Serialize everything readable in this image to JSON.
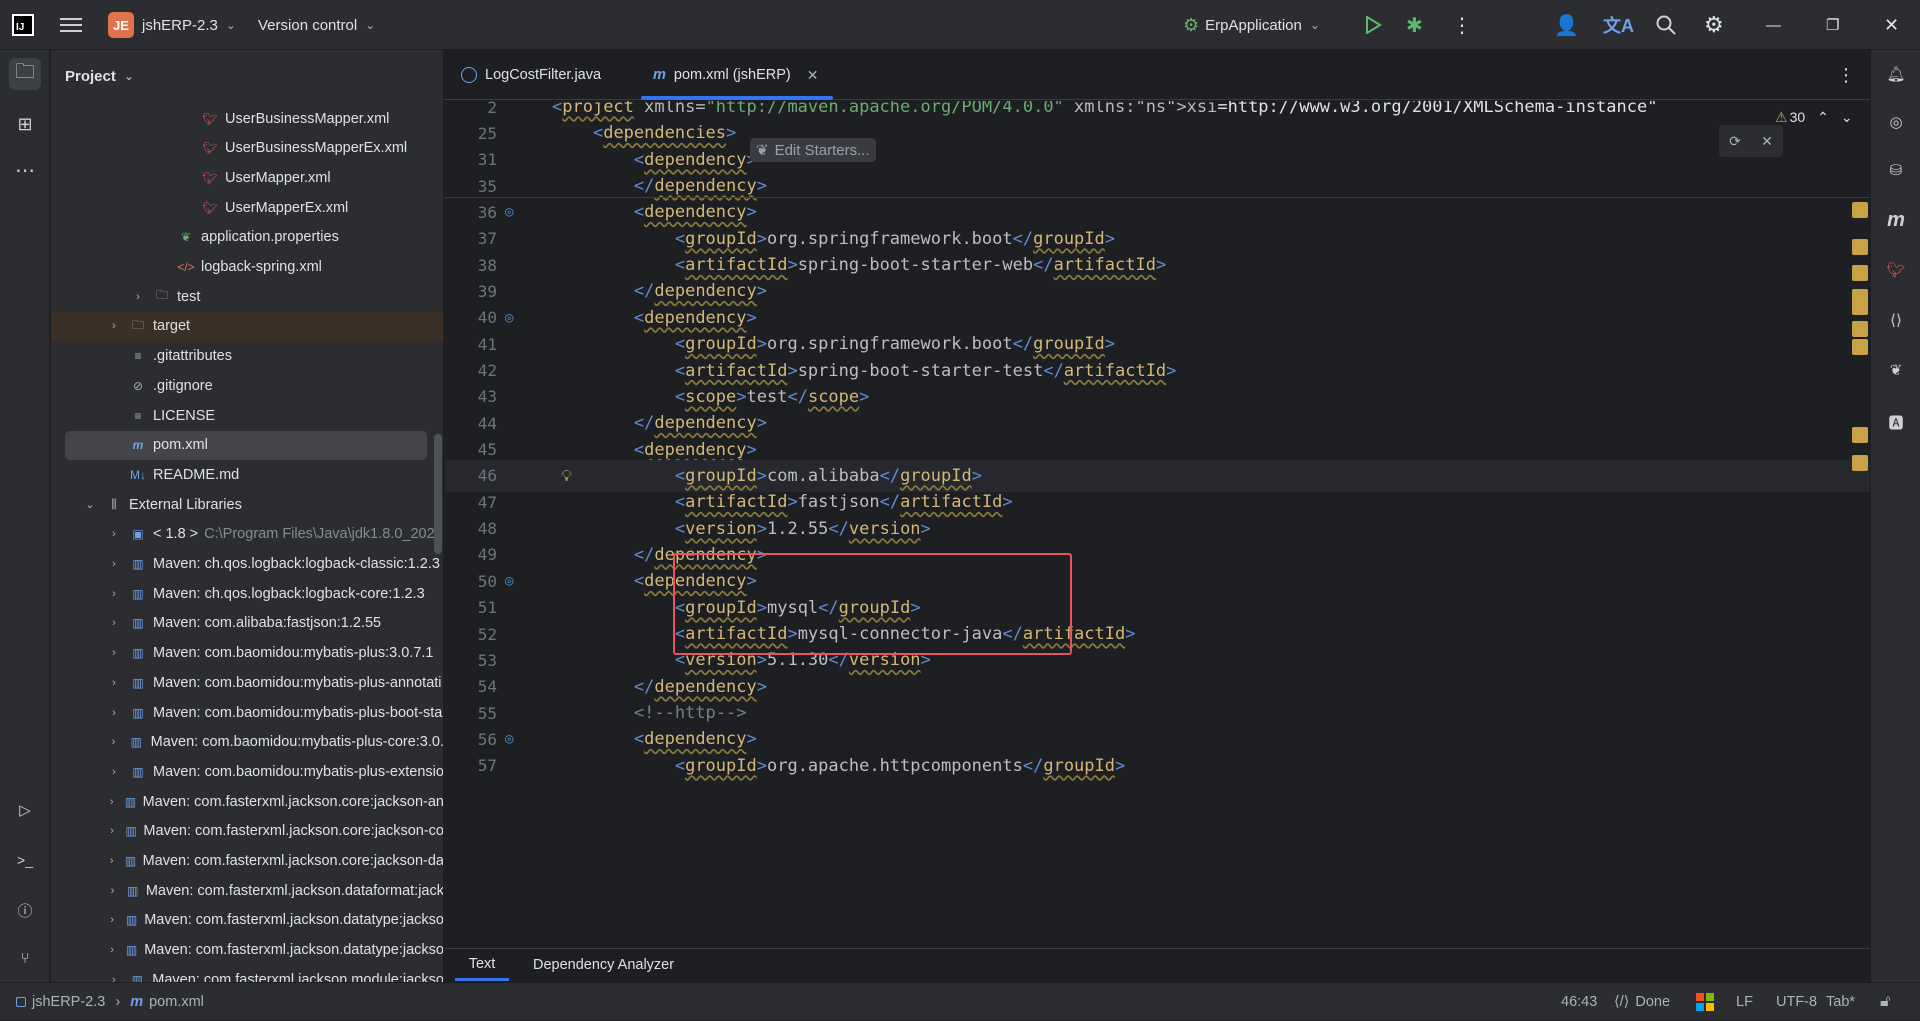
{
  "titlebar": {
    "project_badge": "JE",
    "project_name": "jshERP-2.3",
    "vcs_label": "Version control",
    "run_config": "ErpApplication"
  },
  "project_panel": {
    "title": "Project",
    "rows": [
      {
        "label": "UserBusinessMapper.xml",
        "icon": "mybatis-xml-icon",
        "level": 5
      },
      {
        "label": "UserBusinessMapperEx.xml",
        "icon": "mybatis-xml-icon",
        "level": 5
      },
      {
        "label": "UserMapper.xml",
        "icon": "mybatis-xml-icon",
        "level": 5
      },
      {
        "label": "UserMapperEx.xml",
        "icon": "mybatis-xml-icon",
        "level": 5
      },
      {
        "label": "application.properties",
        "icon": "spring-properties-icon",
        "level": 4
      },
      {
        "label": "logback-spring.xml",
        "icon": "xml-icon",
        "level": 4
      },
      {
        "label": "test",
        "icon": "folder-icon",
        "level": 3,
        "arrow": "›"
      },
      {
        "label": "target",
        "icon": "folder-icon",
        "level": 2,
        "arrow": "›"
      },
      {
        "label": ".gitattributes",
        "icon": "text-file-icon",
        "level": 2
      },
      {
        "label": ".gitignore",
        "icon": "ignore-file-icon",
        "level": 2
      },
      {
        "label": "LICENSE",
        "icon": "text-file-icon",
        "level": 2
      },
      {
        "label": "pom.xml",
        "icon": "maven-icon",
        "level": 2
      },
      {
        "label": "README.md",
        "icon": "markdown-icon",
        "level": 2
      },
      {
        "label": "External Libraries",
        "icon": "library-icon",
        "level": 1,
        "arrow": "⌄"
      },
      {
        "label": "< 1.8 >",
        "extra": "C:\\Program Files\\Java\\jdk1.8.0_202",
        "icon": "jdk-icon",
        "level": 2,
        "arrow": "›"
      },
      {
        "label": "Maven: ch.qos.logback:logback-classic:1.2.3",
        "icon": "jar-icon",
        "level": 2,
        "arrow": "›"
      },
      {
        "label": "Maven: ch.qos.logback:logback-core:1.2.3",
        "icon": "jar-icon",
        "level": 2,
        "arrow": "›"
      },
      {
        "label": "Maven: com.alibaba:fastjson:1.2.55",
        "icon": "jar-icon",
        "level": 2,
        "arrow": "›"
      },
      {
        "label": "Maven: com.baomidou:mybatis-plus:3.0.7.1",
        "icon": "jar-icon",
        "level": 2,
        "arrow": "›"
      },
      {
        "label": "Maven: com.baomidou:mybatis-plus-annotati",
        "icon": "jar-icon",
        "level": 2,
        "arrow": "›"
      },
      {
        "label": "Maven: com.baomidou:mybatis-plus-boot-sta",
        "icon": "jar-icon",
        "level": 2,
        "arrow": "›"
      },
      {
        "label": "Maven: com.baomidou:mybatis-plus-core:3.0.",
        "icon": "jar-icon",
        "level": 2,
        "arrow": "›"
      },
      {
        "label": "Maven: com.baomidou:mybatis-plus-extensio",
        "icon": "jar-icon",
        "level": 2,
        "arrow": "›"
      },
      {
        "label": "Maven: com.fasterxml.jackson.core:jackson-an",
        "icon": "jar-icon",
        "level": 2,
        "arrow": "›"
      },
      {
        "label": "Maven: com.fasterxml.jackson.core:jackson-co",
        "icon": "jar-icon",
        "level": 2,
        "arrow": "›"
      },
      {
        "label": "Maven: com.fasterxml.jackson.core:jackson-da",
        "icon": "jar-icon",
        "level": 2,
        "arrow": "›"
      },
      {
        "label": "Maven: com.fasterxml.jackson.dataformat:jack",
        "icon": "jar-icon",
        "level": 2,
        "arrow": "›"
      },
      {
        "label": "Maven: com.fasterxml.jackson.datatype:jackso",
        "icon": "jar-icon",
        "level": 2,
        "arrow": "›"
      },
      {
        "label": "Maven: com.fasterxml.jackson.datatype:jackso",
        "icon": "jar-icon",
        "level": 2,
        "arrow": "›"
      },
      {
        "label": "Maven: com.fasterxml.jackson.module:jackso",
        "icon": "jar-icon",
        "level": 2,
        "arrow": "›"
      }
    ]
  },
  "tabs": [
    {
      "label": "LogCostFilter.java",
      "icon": "java-class-icon",
      "active": false
    },
    {
      "label": "pom.xml (jshERP)",
      "icon": "maven-icon",
      "active": true
    }
  ],
  "editor": {
    "warning_count": "30",
    "edit_starters_hint": "Edit Starters...",
    "lines": [
      {
        "n": "2",
        "code": "<project xmlns=\"http://maven.apache.org/POM/4.0.0\" xmlns:xsi=\"http://www.w3.org/2001/XMLSchema-instance\""
      },
      {
        "n": "25",
        "code": "    <dependencies>"
      },
      {
        "n": "31",
        "code": "        <dependency>"
      },
      {
        "n": "35",
        "code": "        </dependency>"
      },
      {
        "n": "36",
        "code": "        <dependency>"
      },
      {
        "n": "37",
        "code": "            <groupId>org.springframework.boot</groupId>"
      },
      {
        "n": "38",
        "code": "            <artifactId>spring-boot-starter-web</artifactId>"
      },
      {
        "n": "39",
        "code": "        </dependency>"
      },
      {
        "n": "40",
        "code": "        <dependency>"
      },
      {
        "n": "41",
        "code": "            <groupId>org.springframework.boot</groupId>"
      },
      {
        "n": "42",
        "code": "            <artifactId>spring-boot-starter-test</artifactId>"
      },
      {
        "n": "43",
        "code": "            <scope>test</scope>"
      },
      {
        "n": "44",
        "code": "        </dependency>"
      },
      {
        "n": "45",
        "code": "        <dependency>"
      },
      {
        "n": "46",
        "code": "            <groupId>com.alibaba</groupId>"
      },
      {
        "n": "47",
        "code": "            <artifactId>fastjson</artifactId>"
      },
      {
        "n": "48",
        "code": "            <version>1.2.55</version>"
      },
      {
        "n": "49",
        "code": "        </dependency>"
      },
      {
        "n": "50",
        "code": "        <dependency>"
      },
      {
        "n": "51",
        "code": "            <groupId>mysql</groupId>"
      },
      {
        "n": "52",
        "code": "            <artifactId>mysql-connector-java</artifactId>"
      },
      {
        "n": "53",
        "code": "            <version>5.1.30</version>"
      },
      {
        "n": "54",
        "code": "        </dependency>"
      },
      {
        "n": "55",
        "code": "        <!--http-->"
      },
      {
        "n": "56",
        "code": "        <dependency>"
      },
      {
        "n": "57",
        "code": "            <groupId>org.apache.httpcomponents</groupId>"
      }
    ]
  },
  "bottom_tabs": [
    "Text",
    "Dependency Analyzer"
  ],
  "status": {
    "breadcrumb_project": "jshERP-2.3",
    "breadcrumb_file": "pom.xml",
    "position": "46:43",
    "done": "Done",
    "line_sep": "LF",
    "encoding": "UTF-8",
    "indent": "Tab*"
  },
  "colors": {
    "accent": "#3574f0",
    "highlight_box": "#e5545f",
    "warning": "#c9a248"
  }
}
